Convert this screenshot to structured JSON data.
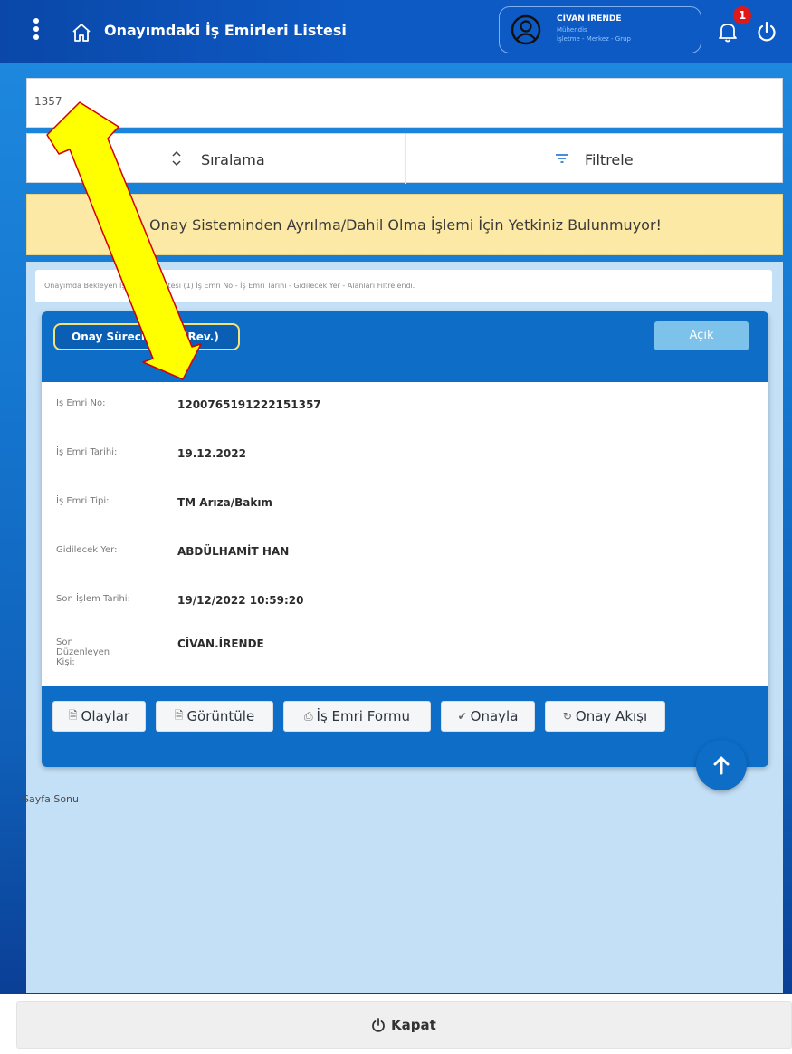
{
  "header": {
    "title": "Onayımdaki İş Emirleri Listesi",
    "user_name": "CİVAN İRENDE",
    "user_role": "Mühendis",
    "user_org": "İşletme - Merkez - Grup",
    "notification_count": "1"
  },
  "search": {
    "value": "1357"
  },
  "sort": {
    "label": "Sıralama"
  },
  "filter": {
    "label": "Filtrele"
  },
  "warning": {
    "text": "Onay Sisteminden Ayrılma/Dahil Olma İşlemi İçin Yetkiniz Bulunmuyor!"
  },
  "results": {
    "info": "Onayımda Bekleyen İş Emirleri Listesi (1) İş Emri No - İş Emri Tarihi - Gidilecek Yer - Alanları Filtrelendi.",
    "page_end": "Sayfa Sonu"
  },
  "card": {
    "badge": "Onay Süreci - Rev.(Rev.)",
    "status": "Açık",
    "fields": [
      {
        "label": "İş Emri No:",
        "value": "1200765191222151357"
      },
      {
        "label": "İş Emri Tarihi:",
        "value": "19.12.2022"
      },
      {
        "label": "İş Emri Tipi:",
        "value": "TM Arıza/Bakım"
      },
      {
        "label": "Gidilecek Yer:",
        "value": "ABDÜLHAMİT HAN"
      },
      {
        "label": "Son İşlem Tarihi:",
        "value": "19/12/2022 10:59:20"
      },
      {
        "label": "Son Düzenleyen Kişi:",
        "value": "CİVAN.İRENDE"
      }
    ],
    "actions": [
      {
        "label": "Olaylar",
        "icon": "document-icon"
      },
      {
        "label": "Görüntüle",
        "icon": "document-icon"
      },
      {
        "label": "İş Emri Formu",
        "icon": "print-icon"
      },
      {
        "label": "Onayla",
        "icon": "check-circle-icon"
      },
      {
        "label": "Onay Akışı",
        "icon": "refresh-icon"
      }
    ]
  },
  "footer": {
    "close_label": "Kapat"
  },
  "colors": {
    "header": "#0d5ac4",
    "card": "#0d6dc7",
    "warning_bg": "#fde9a6",
    "badge_border": "#f3e27a",
    "annotation_arrow": "#ffff00"
  }
}
